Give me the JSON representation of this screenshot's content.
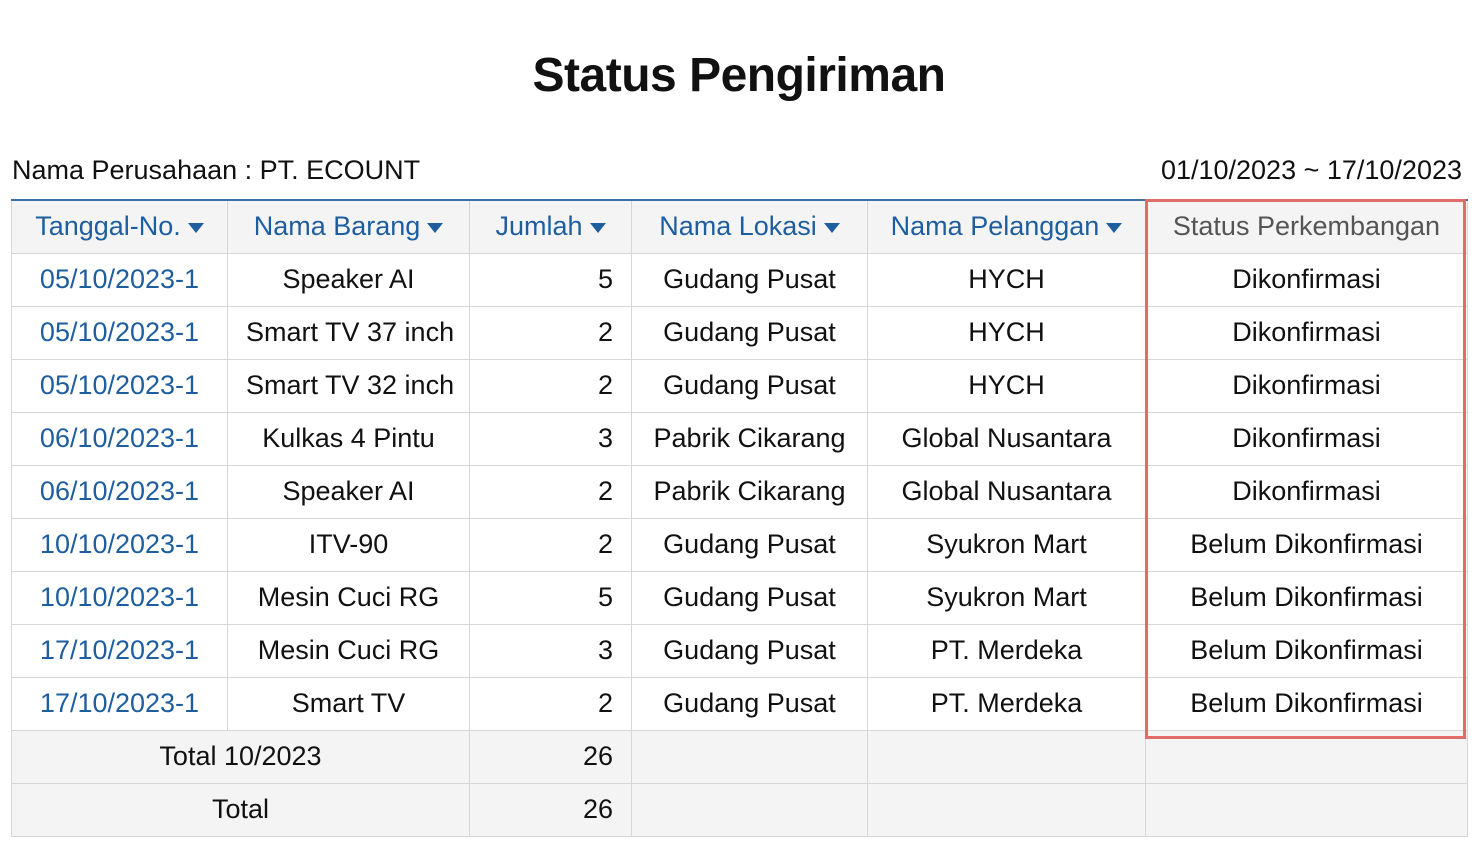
{
  "report": {
    "title": "Status Pengiriman",
    "company_label": "Nama Perusahaan : PT. ECOUNT",
    "date_range": "01/10/2023 ~ 17/10/2023"
  },
  "table": {
    "headers": [
      "Tanggal-No.",
      "Nama Barang",
      "Jumlah",
      "Nama Lokasi",
      "Nama Pelanggan",
      "Status Perkembangan"
    ],
    "rows": [
      {
        "date": "05/10/2023-1",
        "item": "Speaker AI",
        "qty": "5",
        "location": "Gudang Pusat",
        "customer": "HYCH",
        "status": "Dikonfirmasi"
      },
      {
        "date": "05/10/2023-1",
        "item": "Smart TV 37 inch",
        "qty": "2",
        "location": "Gudang Pusat",
        "customer": "HYCH",
        "status": "Dikonfirmasi"
      },
      {
        "date": "05/10/2023-1",
        "item": "Smart TV 32 inch",
        "qty": "2",
        "location": "Gudang Pusat",
        "customer": "HYCH",
        "status": "Dikonfirmasi"
      },
      {
        "date": "06/10/2023-1",
        "item": "Kulkas 4 Pintu",
        "qty": "3",
        "location": "Pabrik Cikarang",
        "customer": "Global Nusantara",
        "status": "Dikonfirmasi"
      },
      {
        "date": "06/10/2023-1",
        "item": "Speaker AI",
        "qty": "2",
        "location": "Pabrik Cikarang",
        "customer": "Global Nusantara",
        "status": "Dikonfirmasi"
      },
      {
        "date": "10/10/2023-1",
        "item": "ITV-90",
        "qty": "2",
        "location": "Gudang Pusat",
        "customer": "Syukron Mart",
        "status": "Belum Dikonfirmasi"
      },
      {
        "date": "10/10/2023-1",
        "item": "Mesin Cuci RG",
        "qty": "5",
        "location": "Gudang Pusat",
        "customer": "Syukron Mart",
        "status": "Belum Dikonfirmasi"
      },
      {
        "date": "17/10/2023-1",
        "item": "Mesin Cuci RG",
        "qty": "3",
        "location": "Gudang Pusat",
        "customer": "PT. Merdeka",
        "status": "Belum Dikonfirmasi"
      },
      {
        "date": "17/10/2023-1",
        "item": "Smart TV",
        "qty": "2",
        "location": "Gudang Pusat",
        "customer": "PT. Merdeka",
        "status": "Belum Dikonfirmasi"
      }
    ],
    "totals": [
      {
        "label": "Total 10/2023",
        "qty": "26"
      },
      {
        "label": "Total",
        "qty": "26"
      }
    ]
  },
  "colors": {
    "link_blue": "#1e5e9f",
    "highlight_red": "#e06b6b",
    "header_bg": "#f4f4f4"
  },
  "icons": {
    "sort": "caret-down-icon"
  }
}
